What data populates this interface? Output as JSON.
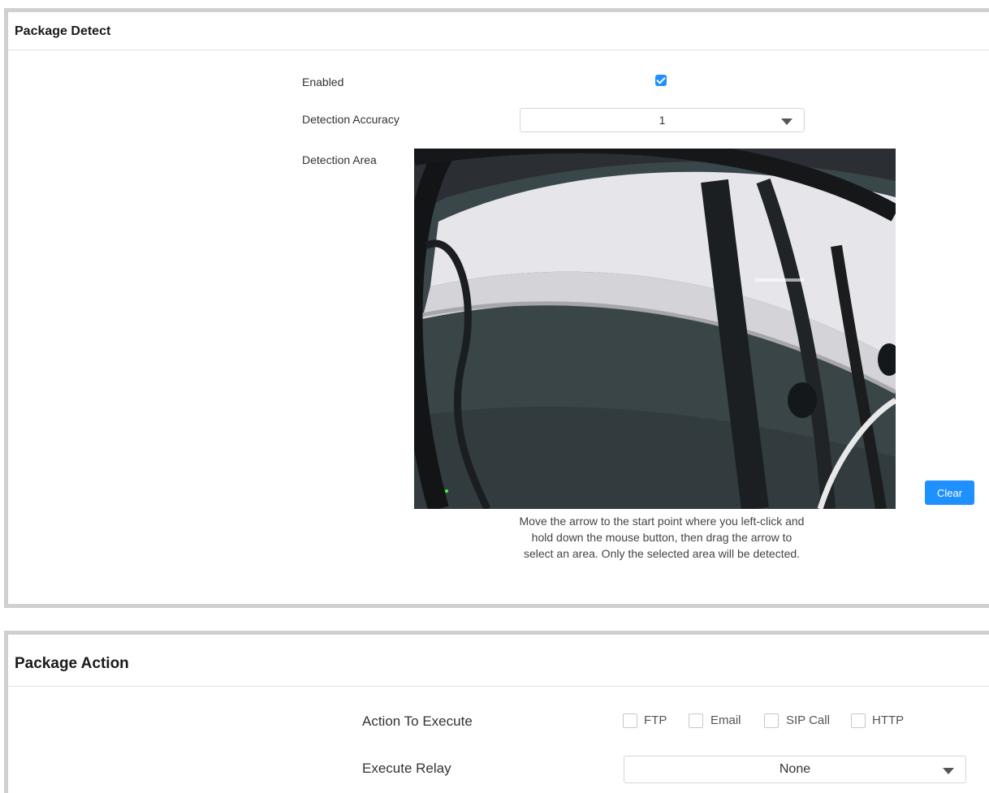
{
  "package_detect": {
    "title": "Package Detect",
    "enabled_label": "Enabled",
    "enabled_checked": true,
    "accuracy_label": "Detection Accuracy",
    "accuracy_value": "1",
    "area_label": "Detection Area",
    "clear_label": "Clear",
    "hint": "Move the arrow to the start point where you left-click and hold down the mouse button, then drag the arrow to select an area. Only the selected area will be detected."
  },
  "package_action": {
    "title": "Package Action",
    "action_label": "Action To Execute",
    "actions": [
      {
        "label": "FTP",
        "checked": false
      },
      {
        "label": "Email",
        "checked": false
      },
      {
        "label": "SIP Call",
        "checked": false
      },
      {
        "label": "HTTP",
        "checked": false
      }
    ],
    "relay_label": "Execute Relay",
    "relay_value": "None"
  },
  "colors": {
    "accent": "#1e90ff",
    "panel_border": "#d0d0d0"
  }
}
